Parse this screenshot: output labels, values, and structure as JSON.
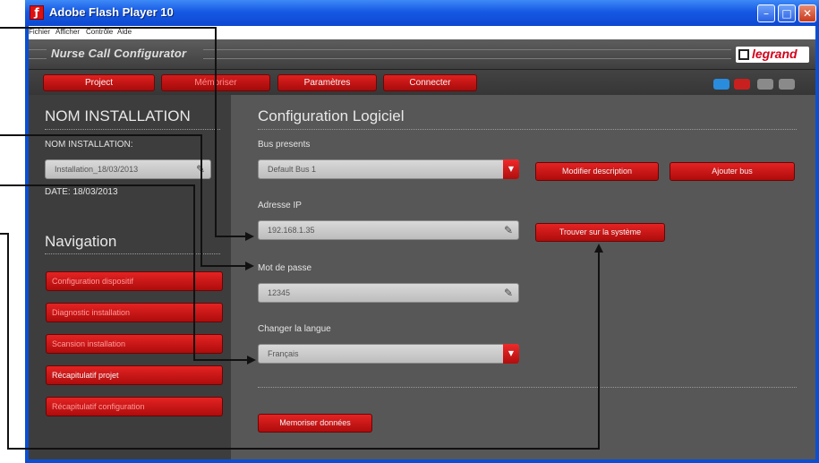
{
  "window": {
    "title": "Adobe Flash Player 10",
    "app_icon": "flash-icon"
  },
  "menubar": {
    "items": [
      "Fichier",
      "Afficher",
      "Contrôle",
      "Aide"
    ]
  },
  "app": {
    "title": "Nurse Call Configurator",
    "logo": "legrand"
  },
  "toolbar": {
    "project": "Project",
    "memoriser": "Mémoriser",
    "parametres": "Paramètres",
    "connecter": "Connecter"
  },
  "sidebar": {
    "installation_title": "NOM INSTALLATION",
    "installation_label": "NOM INSTALLATION:",
    "installation_value": "Installation_18/03/2013",
    "date_label": "DATE: 18/03/2013",
    "nav_title": "Navigation",
    "nav_items": [
      "Configuration dispositif",
      "Diagnostic installation",
      "Scansion installation",
      "Récapitulatif projet",
      "Récapitulatif configuration"
    ]
  },
  "main": {
    "title": "Configuration Logiciel",
    "bus_label": "Bus presents",
    "bus_value": "Default Bus 1",
    "modify_button": "Modifier description",
    "add_bus_button": "Ajouter bus",
    "ip_label": "Adresse IP",
    "ip_value": "192.168.1.35",
    "find_button": "Trouver sur la système",
    "password_label": "Mot de passe",
    "password_value": "12345",
    "language_label": "Changer la langue",
    "language_value": "Français",
    "save_button": "Memoriser données"
  },
  "colors": {
    "accent": "#c91414",
    "titlebar": "#1659e4",
    "panel": "#575757",
    "sidebar": "#3d3d3d"
  }
}
